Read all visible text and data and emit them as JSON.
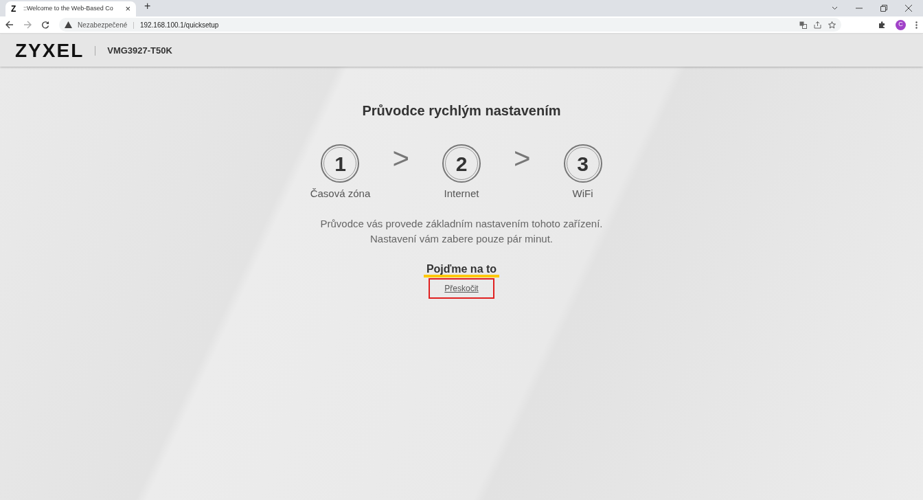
{
  "browser": {
    "tab": {
      "favicon": "Z",
      "title": "::Welcome to the Web-Based Co",
      "close": "×"
    },
    "new_tab": "+",
    "security": "Nezabezpečené",
    "divider": "|",
    "url": "192.168.100.1/quicksetup",
    "profile": "C"
  },
  "header": {
    "logo": "ZYXEL",
    "model": "VMG3927-T50K"
  },
  "title": "Průvodce rychlým nastavením",
  "steps": [
    {
      "number": "1",
      "label": "Časová zóna"
    },
    {
      "number": "2",
      "label": "Internet"
    },
    {
      "number": "3",
      "label": "WiFi"
    }
  ],
  "separator": ">",
  "description": [
    "Průvodce vás provede základním nastavením tohoto zařízení.",
    "Nastavení vám zabere pouze pár minut."
  ],
  "start_button": "Pojďme na to",
  "skip_link": {
    "label": "Přeskočit",
    "highlighted": true
  }
}
